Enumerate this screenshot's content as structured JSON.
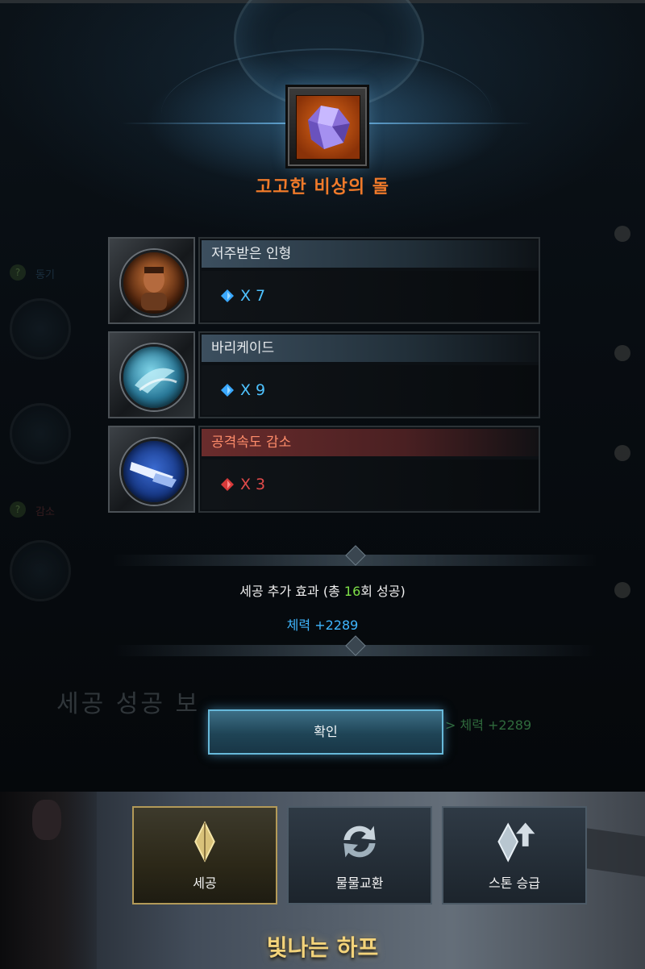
{
  "item": {
    "name": "고고한 비상의 돌",
    "icon": "purple-crystal-icon",
    "name_color": "#f07a2a"
  },
  "effects": [
    {
      "name": "저주받은 인형",
      "gem": "blue-gem-icon",
      "value": "X 7",
      "type": "positive"
    },
    {
      "name": "바리케이드",
      "gem": "blue-gem-icon",
      "value": "X 9",
      "type": "positive"
    },
    {
      "name": "공격속도 감소",
      "gem": "red-gem-icon",
      "value": "X 3",
      "type": "negative"
    }
  ],
  "bonus": {
    "title_prefix": "세공 추가 효과 (총 ",
    "success_count": "16",
    "title_suffix": "회 성공)",
    "stat": "체력 +2289",
    "count_color": "#7ee048",
    "stat_color": "#3fb6ff"
  },
  "confirm_label": "확인",
  "background": {
    "ghost_text": "세공 성공 보",
    "ghost_stat": "> 체력 +2289",
    "ghost_labels": [
      "동기",
      "감소"
    ]
  },
  "bottom_menu": [
    {
      "label": "세공",
      "icon": "crystal-icon",
      "active": true
    },
    {
      "label": "물물교환",
      "icon": "exchange-icon",
      "active": false
    },
    {
      "label": "스톤 승급",
      "icon": "upgrade-crystal-icon",
      "active": false
    }
  ],
  "event_title": "빛나는 하프",
  "colors": {
    "blue": "#4ec2ff",
    "red": "#e04a4a",
    "accent_button": "#67b9da"
  }
}
